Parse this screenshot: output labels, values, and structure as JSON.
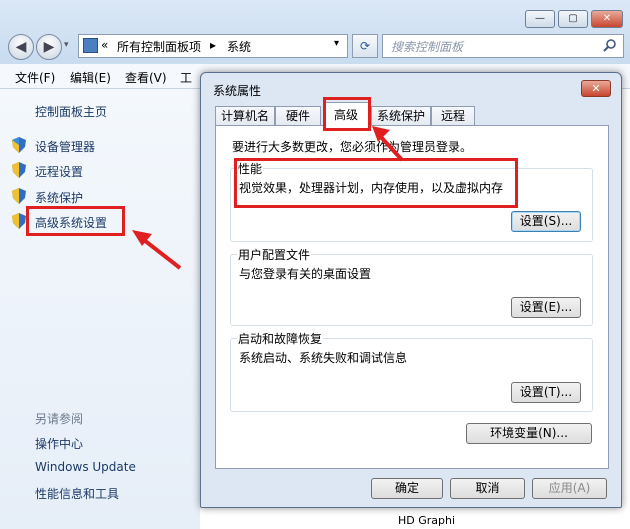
{
  "explorer": {
    "title_buttons": [
      "—",
      "▢",
      "✕"
    ],
    "address": {
      "prefix": "«",
      "path1": "所有控制面板项",
      "sep": "▸",
      "path2": "系统"
    },
    "search": {
      "placeholder": "搜索控制面板"
    },
    "menu": [
      "文件(F)",
      "编辑(E)",
      "查看(V)",
      "工"
    ],
    "sidebar": {
      "home": "控制面板主页",
      "items": [
        "设备管理器",
        "远程设置",
        "系统保护",
        "高级系统设置"
      ],
      "see_also_title": "另请参阅",
      "see_also": [
        "操作中心",
        "Windows Update",
        "性能信息和工具"
      ]
    },
    "bottom_text": "HD Graphi"
  },
  "dialog": {
    "title": "系统属性",
    "close": "✕",
    "tabs": [
      "计算机名",
      "硬件",
      "高级",
      "系统保护",
      "远程"
    ],
    "active_tab": "高级",
    "admin_note": "要进行大多数更改，您必须作为管理员登录。",
    "groups": [
      {
        "label": "性能",
        "desc": "视觉效果，处理器计划，内存使用，以及虚拟内存",
        "button": "设置(S)..."
      },
      {
        "label": "用户配置文件",
        "desc": "与您登录有关的桌面设置",
        "button": "设置(E)..."
      },
      {
        "label": "启动和故障恢复",
        "desc": "系统启动、系统失败和调试信息",
        "button": "设置(T)..."
      }
    ],
    "env_button": "环境变量(N)...",
    "ok": "确定",
    "cancel": "取消",
    "apply": "应用(A)"
  },
  "colors": {
    "annotation_red": "#e02020",
    "link_blue": "#1c3a66"
  }
}
